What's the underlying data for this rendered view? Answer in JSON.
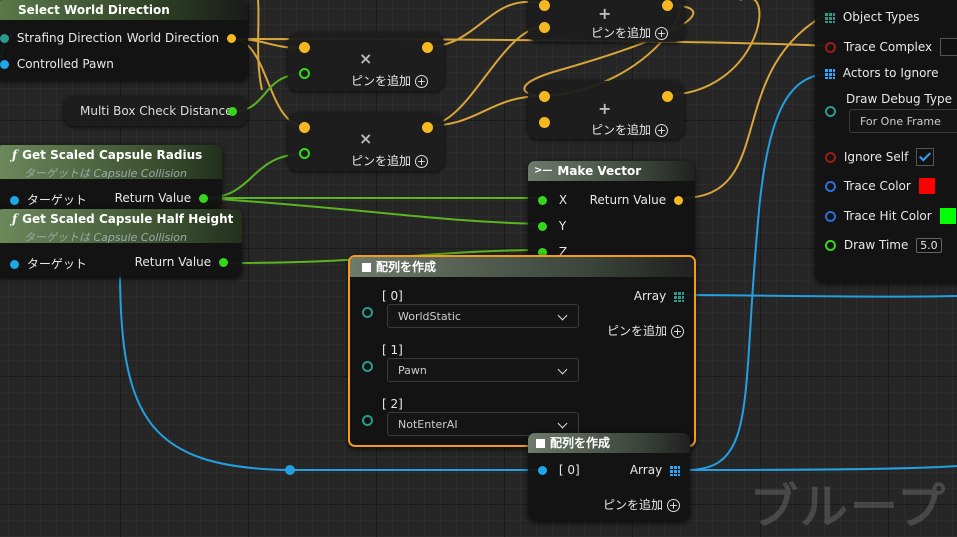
{
  "nodes": {
    "select": {
      "title": "Select World Direction",
      "in_strafing": "Strafing Direction",
      "in_pawn": "Controlled Pawn",
      "out": "World Direction"
    },
    "multibox": {
      "label": "Multi Box Check Distance"
    },
    "radius": {
      "title": "Get Scaled Capsule Radius",
      "subtitle": "ターゲットは Capsule Collision",
      "in_target": "ターゲット",
      "out": "Return Value"
    },
    "halfheight": {
      "title": "Get Scaled Capsule Half Height",
      "subtitle": "ターゲットは Capsule Collision",
      "in_target": "ターゲット",
      "out": "Return Value"
    },
    "mult1": {
      "symbol": "×",
      "addpin": "ピンを追加"
    },
    "mult2": {
      "symbol": "×",
      "addpin": "ピンを追加"
    },
    "add1": {
      "symbol": "+",
      "addpin": "ピンを追加"
    },
    "add2": {
      "symbol": "+",
      "addpin": "ピンを追加"
    },
    "makevector": {
      "title": "Make Vector",
      "x": "X",
      "y": "Y",
      "z": "Z",
      "out": "Return Value"
    },
    "makearray1": {
      "title": "配列を作成",
      "out": "Array",
      "addpin": "ピンを追加",
      "items": [
        {
          "index": "[ 0]",
          "value": "WorldStatic"
        },
        {
          "index": "[ 1]",
          "value": "Pawn"
        },
        {
          "index": "[ 2]",
          "value": "NotEnterAI"
        }
      ]
    },
    "makearray2": {
      "title": "配列を作成",
      "item": "[ 0]",
      "out": "Array",
      "addpin": "ピンを追加"
    },
    "trace": {
      "object_types": "Object Types",
      "trace_complex": "Trace Complex",
      "actors_ignore": "Actors to Ignore",
      "draw_debug": "Draw Debug Type",
      "draw_debug_value": "For One Frame",
      "ignore_self": "Ignore Self",
      "trace_color": "Trace Color",
      "trace_hit_color": "Trace Hit Color",
      "draw_time": "Draw Time",
      "draw_time_value": "5.0",
      "trace_color_hex": "#ff0000",
      "trace_hit_color_hex": "#00ff00",
      "ignore_self_checked": true,
      "trace_complex_checked": false
    }
  },
  "watermark": "ブループ",
  "colors": {
    "exec": "#ffffff",
    "float": "#35d61c",
    "vector": "#f5b821",
    "object": "#1ea6e8",
    "bool": "#9a1c1c",
    "struct": "#2b6fd6",
    "array": "#29a8ff",
    "teal": "#2c9a8a",
    "wire_float": "#5ab521",
    "wire_vector": "#d8a63b",
    "wire_object": "#24a0e0"
  }
}
